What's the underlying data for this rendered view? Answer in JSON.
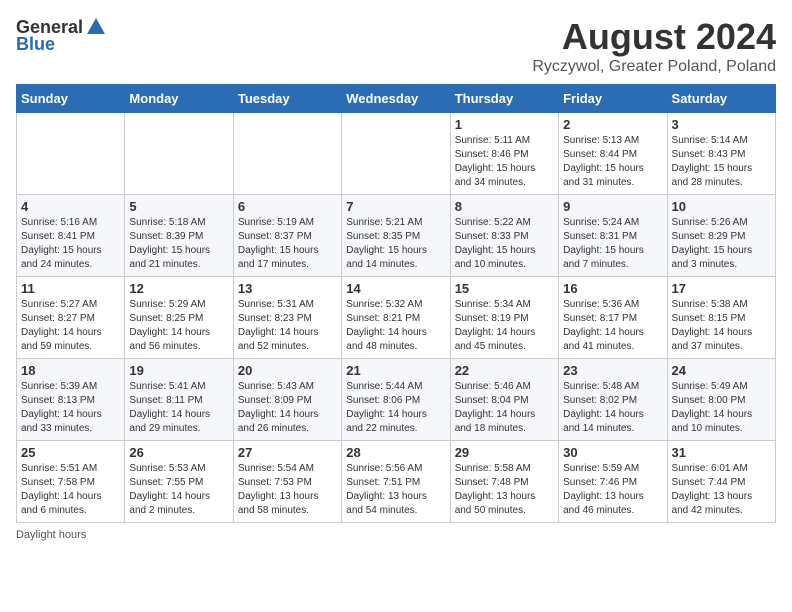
{
  "logo": {
    "general": "General",
    "blue": "Blue"
  },
  "title": "August 2024",
  "subtitle": "Ryczywol, Greater Poland, Poland",
  "days_of_week": [
    "Sunday",
    "Monday",
    "Tuesday",
    "Wednesday",
    "Thursday",
    "Friday",
    "Saturday"
  ],
  "weeks": [
    [
      {
        "day": "",
        "info": ""
      },
      {
        "day": "",
        "info": ""
      },
      {
        "day": "",
        "info": ""
      },
      {
        "day": "",
        "info": ""
      },
      {
        "day": "1",
        "info": "Sunrise: 5:11 AM\nSunset: 8:46 PM\nDaylight: 15 hours\nand 34 minutes."
      },
      {
        "day": "2",
        "info": "Sunrise: 5:13 AM\nSunset: 8:44 PM\nDaylight: 15 hours\nand 31 minutes."
      },
      {
        "day": "3",
        "info": "Sunrise: 5:14 AM\nSunset: 8:43 PM\nDaylight: 15 hours\nand 28 minutes."
      }
    ],
    [
      {
        "day": "4",
        "info": "Sunrise: 5:16 AM\nSunset: 8:41 PM\nDaylight: 15 hours\nand 24 minutes."
      },
      {
        "day": "5",
        "info": "Sunrise: 5:18 AM\nSunset: 8:39 PM\nDaylight: 15 hours\nand 21 minutes."
      },
      {
        "day": "6",
        "info": "Sunrise: 5:19 AM\nSunset: 8:37 PM\nDaylight: 15 hours\nand 17 minutes."
      },
      {
        "day": "7",
        "info": "Sunrise: 5:21 AM\nSunset: 8:35 PM\nDaylight: 15 hours\nand 14 minutes."
      },
      {
        "day": "8",
        "info": "Sunrise: 5:22 AM\nSunset: 8:33 PM\nDaylight: 15 hours\nand 10 minutes."
      },
      {
        "day": "9",
        "info": "Sunrise: 5:24 AM\nSunset: 8:31 PM\nDaylight: 15 hours\nand 7 minutes."
      },
      {
        "day": "10",
        "info": "Sunrise: 5:26 AM\nSunset: 8:29 PM\nDaylight: 15 hours\nand 3 minutes."
      }
    ],
    [
      {
        "day": "11",
        "info": "Sunrise: 5:27 AM\nSunset: 8:27 PM\nDaylight: 14 hours\nand 59 minutes."
      },
      {
        "day": "12",
        "info": "Sunrise: 5:29 AM\nSunset: 8:25 PM\nDaylight: 14 hours\nand 56 minutes."
      },
      {
        "day": "13",
        "info": "Sunrise: 5:31 AM\nSunset: 8:23 PM\nDaylight: 14 hours\nand 52 minutes."
      },
      {
        "day": "14",
        "info": "Sunrise: 5:32 AM\nSunset: 8:21 PM\nDaylight: 14 hours\nand 48 minutes."
      },
      {
        "day": "15",
        "info": "Sunrise: 5:34 AM\nSunset: 8:19 PM\nDaylight: 14 hours\nand 45 minutes."
      },
      {
        "day": "16",
        "info": "Sunrise: 5:36 AM\nSunset: 8:17 PM\nDaylight: 14 hours\nand 41 minutes."
      },
      {
        "day": "17",
        "info": "Sunrise: 5:38 AM\nSunset: 8:15 PM\nDaylight: 14 hours\nand 37 minutes."
      }
    ],
    [
      {
        "day": "18",
        "info": "Sunrise: 5:39 AM\nSunset: 8:13 PM\nDaylight: 14 hours\nand 33 minutes."
      },
      {
        "day": "19",
        "info": "Sunrise: 5:41 AM\nSunset: 8:11 PM\nDaylight: 14 hours\nand 29 minutes."
      },
      {
        "day": "20",
        "info": "Sunrise: 5:43 AM\nSunset: 8:09 PM\nDaylight: 14 hours\nand 26 minutes."
      },
      {
        "day": "21",
        "info": "Sunrise: 5:44 AM\nSunset: 8:06 PM\nDaylight: 14 hours\nand 22 minutes."
      },
      {
        "day": "22",
        "info": "Sunrise: 5:46 AM\nSunset: 8:04 PM\nDaylight: 14 hours\nand 18 minutes."
      },
      {
        "day": "23",
        "info": "Sunrise: 5:48 AM\nSunset: 8:02 PM\nDaylight: 14 hours\nand 14 minutes."
      },
      {
        "day": "24",
        "info": "Sunrise: 5:49 AM\nSunset: 8:00 PM\nDaylight: 14 hours\nand 10 minutes."
      }
    ],
    [
      {
        "day": "25",
        "info": "Sunrise: 5:51 AM\nSunset: 7:58 PM\nDaylight: 14 hours\nand 6 minutes."
      },
      {
        "day": "26",
        "info": "Sunrise: 5:53 AM\nSunset: 7:55 PM\nDaylight: 14 hours\nand 2 minutes."
      },
      {
        "day": "27",
        "info": "Sunrise: 5:54 AM\nSunset: 7:53 PM\nDaylight: 13 hours\nand 58 minutes."
      },
      {
        "day": "28",
        "info": "Sunrise: 5:56 AM\nSunset: 7:51 PM\nDaylight: 13 hours\nand 54 minutes."
      },
      {
        "day": "29",
        "info": "Sunrise: 5:58 AM\nSunset: 7:48 PM\nDaylight: 13 hours\nand 50 minutes."
      },
      {
        "day": "30",
        "info": "Sunrise: 5:59 AM\nSunset: 7:46 PM\nDaylight: 13 hours\nand 46 minutes."
      },
      {
        "day": "31",
        "info": "Sunrise: 6:01 AM\nSunset: 7:44 PM\nDaylight: 13 hours\nand 42 minutes."
      }
    ]
  ],
  "footer": "Daylight hours"
}
